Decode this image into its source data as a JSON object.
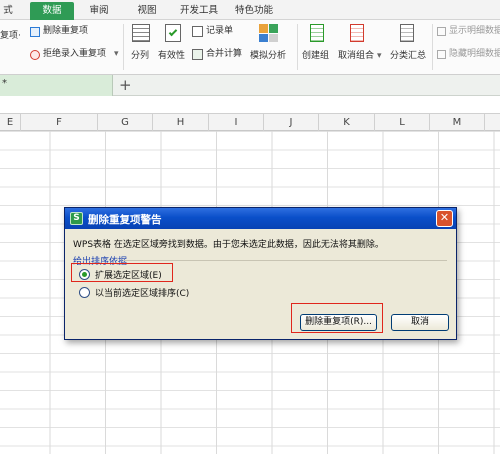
{
  "ribbon_tabs": [
    "式",
    "数据",
    "审阅",
    "视图",
    "开发工具",
    "特色功能"
  ],
  "ribbon": {
    "remove_duplicates": "删除重复项",
    "reject_duplicates": "拒绝录入重复项",
    "left_partial_1": "复项·",
    "split": "分列",
    "validity": "有效性",
    "record_form": "记录单",
    "consolidate": "合并计算",
    "what_if": "模拟分析",
    "group": "创建组",
    "ungroup": "取消组合",
    "subtotal": "分类汇总",
    "show_detail": "显示明细数据",
    "hide_detail": "隐藏明细数据"
  },
  "doc_tab": {
    "label": "*",
    "add": "+"
  },
  "columns": [
    "E",
    "F",
    "G",
    "H",
    "I",
    "J",
    "K",
    "L",
    "M"
  ],
  "dialog": {
    "title": "删除重复项警告",
    "app_icon_letter": "S",
    "close": "✕",
    "message": "WPS表格 在选定区域旁找到数据。由于您未选定此数据，因此无法将其删除。",
    "group_label": "给出排序依据",
    "option_expand": "扩展选定区域(E)",
    "option_current": "以当前选定区域排序(C)",
    "btn_remove": "删除重复项(R)...",
    "btn_cancel": "取消"
  },
  "colors": {
    "accent_green": "#2f9b55",
    "title_blue": "#0a4fc9",
    "highlight_red": "#e0261c"
  }
}
